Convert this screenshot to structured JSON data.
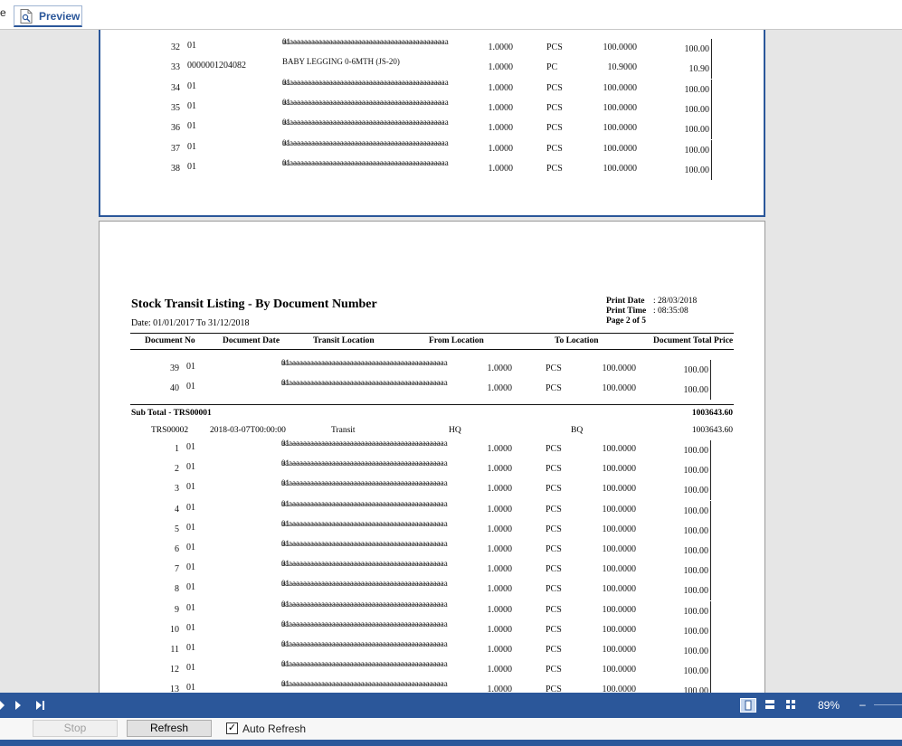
{
  "tabs": {
    "previous_label": "e",
    "preview_label": "Preview"
  },
  "page1_rows": [
    {
      "no": "32",
      "code": "01",
      "desc1": "01 --------------------------------------------------------",
      "desc2": "aaaaaaaaaaaaaaaaaaaaaaaaaaaaaaaaaaaaaaaaaaaaaa",
      "qty": "1.0000",
      "uom": "PCS",
      "price": "100.0000",
      "total": "100.00"
    },
    {
      "no": "33",
      "code": "0000001204082",
      "desc1": "BABY LEGGING 0-6MTH (JS-20)",
      "desc2": "",
      "qty": "1.0000",
      "uom": "PC",
      "price": "10.9000",
      "total": "10.90"
    },
    {
      "no": "34",
      "code": "01",
      "desc1": "01 --------------------------------------------------------",
      "desc2": "aaaaaaaaaaaaaaaaaaaaaaaaaaaaaaaaaaaaaaaaaaaaaa",
      "qty": "1.0000",
      "uom": "PCS",
      "price": "100.0000",
      "total": "100.00"
    },
    {
      "no": "35",
      "code": "01",
      "desc1": "01 --------------------------------------------------------",
      "desc2": "aaaaaaaaaaaaaaaaaaaaaaaaaaaaaaaaaaaaaaaaaaaaaa",
      "qty": "1.0000",
      "uom": "PCS",
      "price": "100.0000",
      "total": "100.00"
    },
    {
      "no": "36",
      "code": "01",
      "desc1": "01 --------------------------------------------------------",
      "desc2": "aaaaaaaaaaaaaaaaaaaaaaaaaaaaaaaaaaaaaaaaaaaaaa",
      "qty": "1.0000",
      "uom": "PCS",
      "price": "100.0000",
      "total": "100.00"
    },
    {
      "no": "37",
      "code": "01",
      "desc1": "01 --------------------------------------------------------",
      "desc2": "aaaaaaaaaaaaaaaaaaaaaaaaaaaaaaaaaaaaaaaaaaaaaa",
      "qty": "1.0000",
      "uom": "PCS",
      "price": "100.0000",
      "total": "100.00"
    },
    {
      "no": "38",
      "code": "01",
      "desc1": "01 --------------------------------------------------------",
      "desc2": "aaaaaaaaaaaaaaaaaaaaaaaaaaaaaaaaaaaaaaaaaaaaaa",
      "qty": "1.0000",
      "uom": "PCS",
      "price": "100.0000",
      "total": "100.00"
    }
  ],
  "report": {
    "title": "Stock Transit Listing - By Document Number",
    "date_range": "Date: 01/01/2017  To  31/12/2018",
    "print_date_label": "Print  Date",
    "print_date_value": ": 28/03/2018",
    "print_time_label": "Print  Time",
    "print_time_value": ": 08:35:08",
    "page_label": "Page 2 of 5",
    "columns": [
      "Document No",
      "Document Date",
      "Transit Location",
      "From Location",
      "To Location",
      "Document Total Price"
    ],
    "subtotal_label": "Sub Total - TRS00001",
    "subtotal_value": "1003643.60",
    "document": {
      "no": "TRS00002",
      "date": "2018-03-07T00:00:00",
      "transit": "Transit",
      "from": "HQ",
      "to": "BQ",
      "total": "1003643.60"
    }
  },
  "page2_top_rows": [
    {
      "no": "39",
      "code": "01",
      "desc1": "01 --------------------------------------------------------",
      "desc2": "aaaaaaaaaaaaaaaaaaaaaaaaaaaaaaaaaaaaaaaaaaaaaa",
      "qty": "1.0000",
      "uom": "PCS",
      "price": "100.0000",
      "total": "100.00"
    },
    {
      "no": "40",
      "code": "01",
      "desc1": "01 --------------------------------------------------------",
      "desc2": "aaaaaaaaaaaaaaaaaaaaaaaaaaaaaaaaaaaaaaaaaaaaaa",
      "qty": "1.0000",
      "uom": "PCS",
      "price": "100.0000",
      "total": "100.00"
    }
  ],
  "page2_doc_rows": [
    {
      "no": "1",
      "code": "01",
      "desc1": "01 --------------------------------------------------------",
      "desc2": "aaaaaaaaaaaaaaaaaaaaaaaaaaaaaaaaaaaaaaaaaaaaaa",
      "qty": "1.0000",
      "uom": "PCS",
      "price": "100.0000",
      "total": "100.00"
    },
    {
      "no": "2",
      "code": "01",
      "desc1": "01 --------------------------------------------------------",
      "desc2": "aaaaaaaaaaaaaaaaaaaaaaaaaaaaaaaaaaaaaaaaaaaaaa",
      "qty": "1.0000",
      "uom": "PCS",
      "price": "100.0000",
      "total": "100.00"
    },
    {
      "no": "3",
      "code": "01",
      "desc1": "01 --------------------------------------------------------",
      "desc2": "aaaaaaaaaaaaaaaaaaaaaaaaaaaaaaaaaaaaaaaaaaaaaa",
      "qty": "1.0000",
      "uom": "PCS",
      "price": "100.0000",
      "total": "100.00"
    },
    {
      "no": "4",
      "code": "01",
      "desc1": "01 --------------------------------------------------------",
      "desc2": "aaaaaaaaaaaaaaaaaaaaaaaaaaaaaaaaaaaaaaaaaaaaaa",
      "qty": "1.0000",
      "uom": "PCS",
      "price": "100.0000",
      "total": "100.00"
    },
    {
      "no": "5",
      "code": "01",
      "desc1": "01 --------------------------------------------------------",
      "desc2": "aaaaaaaaaaaaaaaaaaaaaaaaaaaaaaaaaaaaaaaaaaaaaa",
      "qty": "1.0000",
      "uom": "PCS",
      "price": "100.0000",
      "total": "100.00"
    },
    {
      "no": "6",
      "code": "01",
      "desc1": "01 --------------------------------------------------------",
      "desc2": "aaaaaaaaaaaaaaaaaaaaaaaaaaaaaaaaaaaaaaaaaaaaaa",
      "qty": "1.0000",
      "uom": "PCS",
      "price": "100.0000",
      "total": "100.00"
    },
    {
      "no": "7",
      "code": "01",
      "desc1": "01 --------------------------------------------------------",
      "desc2": "aaaaaaaaaaaaaaaaaaaaaaaaaaaaaaaaaaaaaaaaaaaaaa",
      "qty": "1.0000",
      "uom": "PCS",
      "price": "100.0000",
      "total": "100.00"
    },
    {
      "no": "8",
      "code": "01",
      "desc1": "01 --------------------------------------------------------",
      "desc2": "aaaaaaaaaaaaaaaaaaaaaaaaaaaaaaaaaaaaaaaaaaaaaa",
      "qty": "1.0000",
      "uom": "PCS",
      "price": "100.0000",
      "total": "100.00"
    },
    {
      "no": "9",
      "code": "01",
      "desc1": "01 --------------------------------------------------------",
      "desc2": "aaaaaaaaaaaaaaaaaaaaaaaaaaaaaaaaaaaaaaaaaaaaaa",
      "qty": "1.0000",
      "uom": "PCS",
      "price": "100.0000",
      "total": "100.00"
    },
    {
      "no": "10",
      "code": "01",
      "desc1": "01 --------------------------------------------------------",
      "desc2": "aaaaaaaaaaaaaaaaaaaaaaaaaaaaaaaaaaaaaaaaaaaaaa",
      "qty": "1.0000",
      "uom": "PCS",
      "price": "100.0000",
      "total": "100.00"
    },
    {
      "no": "11",
      "code": "01",
      "desc1": "01 --------------------------------------------------------",
      "desc2": "aaaaaaaaaaaaaaaaaaaaaaaaaaaaaaaaaaaaaaaaaaaaaa",
      "qty": "1.0000",
      "uom": "PCS",
      "price": "100.0000",
      "total": "100.00"
    },
    {
      "no": "12",
      "code": "01",
      "desc1": "01 --------------------------------------------------------",
      "desc2": "aaaaaaaaaaaaaaaaaaaaaaaaaaaaaaaaaaaaaaaaaaaaaa",
      "qty": "1.0000",
      "uom": "PCS",
      "price": "100.0000",
      "total": "100.00"
    },
    {
      "no": "13",
      "code": "01",
      "desc1": "01 --------------------------------------------------------",
      "desc2": "aaaaaaaaaaaaaaaaaaaaaaaaaaaaaaaaaaaaaaaaaaaaaa",
      "qty": "1.0000",
      "uom": "PCS",
      "price": "100.0000",
      "total": "100.00"
    }
  ],
  "navbar": {
    "zoom": "89%",
    "zoom_minus": "–",
    "view_icons": [
      "single-page-icon",
      "two-page-icon",
      "multi-page-icon"
    ]
  },
  "toolbar": {
    "stop_label": "Stop",
    "refresh_label": "Refresh",
    "auto_refresh_label": "Auto Refresh",
    "auto_refresh_checked": true,
    "check_mark": "✓"
  },
  "colors": {
    "accent": "#2b579a",
    "page_bg": "#ffffff",
    "canvas_bg": "#e6e6e6"
  }
}
